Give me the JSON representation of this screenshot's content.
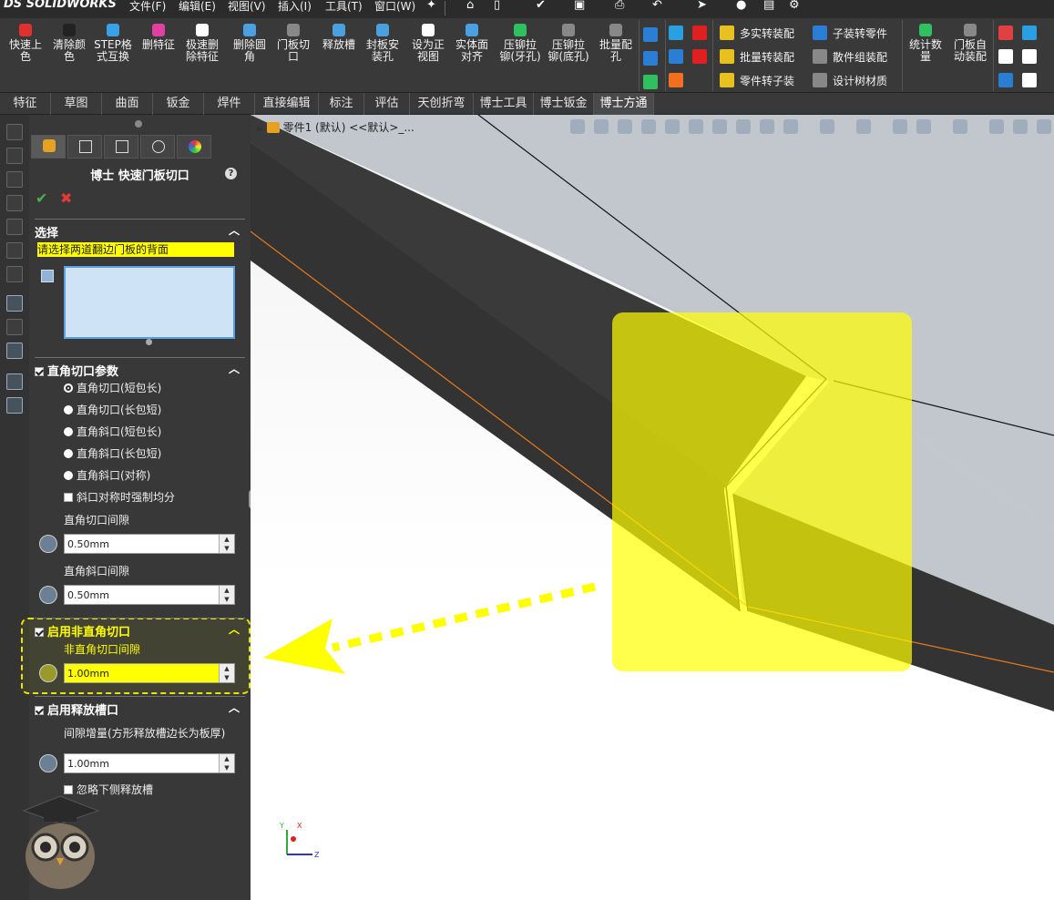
{
  "menubar": {
    "logo_ds": "DS",
    "logo_text": "SOLIDWORKS",
    "items": [
      "文件(F)",
      "编辑(E)",
      "视图(V)",
      "插入(I)",
      "工具(T)",
      "窗口(W)"
    ],
    "pin_icon": "pin-icon"
  },
  "ribbon": {
    "buttons": [
      {
        "label": "快速上\n色",
        "icon": "red-dot-icon",
        "color": "#e03030"
      },
      {
        "label": "清除颜\n色",
        "icon": "palette-icon",
        "color": "#222222"
      },
      {
        "label": "STEP格\n式互换",
        "icon": "globe-icon",
        "color": "#3aa0e8"
      },
      {
        "label": "删特征",
        "icon": "pink-delete-icon",
        "color": "#e040a0"
      },
      {
        "label": "极速删\n除特征",
        "icon": "n-icon",
        "color": "#ffffff"
      },
      {
        "label": "删除圆\n角",
        "icon": "fillet-icon",
        "color": "#4aa0e0"
      },
      {
        "label": "门板切\n口",
        "icon": "door-cut-icon",
        "color": "#888888"
      },
      {
        "label": "释放槽",
        "icon": "relief-icon",
        "color": "#4aa0e0"
      },
      {
        "label": "封板安\n装孔",
        "icon": "target-icon",
        "color": "#4aa0e0"
      },
      {
        "label": "设为正\n视图",
        "icon": "front-view-icon",
        "color": "#ffffff"
      },
      {
        "label": "实体面\n对齐",
        "icon": "align-icon",
        "color": "#4aa0e0"
      },
      {
        "label": "压铆拉\n铆(牙孔)",
        "icon": "rivet-icon",
        "color": "#30c060"
      },
      {
        "label": "压铆拉\n铆(底孔)",
        "icon": "rivet-bottom-icon",
        "color": "#888888"
      },
      {
        "label": "批量配\n孔",
        "icon": "batch-hole-icon",
        "color": "#888888"
      }
    ],
    "list_right": [
      {
        "label": "多实转装配",
        "icon": "multi-body-icon"
      },
      {
        "label": "批量转装配",
        "icon": "batch-assembly-icon"
      },
      {
        "label": "零件转子装",
        "icon": "part-sub-icon"
      },
      {
        "label": "子装转零件",
        "icon": "sub-part-icon"
      },
      {
        "label": "散件组装配",
        "icon": "parts-assembly-icon"
      },
      {
        "label": "设计树材质",
        "icon": "material-icon"
      }
    ],
    "stat_label": "统计数\n量",
    "door_auto_label": "门板自\n动装配"
  },
  "tabs": [
    "特征",
    "草图",
    "曲面",
    "钣金",
    "焊件",
    "直接编辑",
    "标注",
    "评估",
    "天创折弯",
    "博士工具",
    "博士钣金",
    "博士方通"
  ],
  "active_tab": "博士方通",
  "panel": {
    "title": "博士 快速门板切口",
    "help_icon": "help-icon",
    "ok_icon": "check-icon",
    "cancel_icon": "close-icon",
    "selection": {
      "header": "选择",
      "prompt": "请选择两道翻边门板的背面"
    },
    "right_angle": {
      "header": "直角切口参数",
      "options": [
        "直角切口(短包长)",
        "直角切口(长包短)",
        "直角斜口(短包长)",
        "直角斜口(长包短)",
        "直角斜口(对称)"
      ],
      "selected_index": 0,
      "force_even_label": "斜口对称时强制均分",
      "gap1_label": "直角切口间隙",
      "gap1_value": "0.50mm",
      "gap2_label": "直角斜口间隙",
      "gap2_value": "0.50mm"
    },
    "non_right": {
      "header": "启用非直角切口",
      "gap_label": "非直角切口间隙",
      "gap_value": "1.00mm"
    },
    "relief": {
      "header": "启用释放槽口",
      "gap_label": "间隙增量(方形释放槽边长为板厚)",
      "gap_value": "1.00mm",
      "ignore_label": "忽略下侧释放槽"
    }
  },
  "viewport": {
    "tree_label": "零件1 (默认) <<默认>_..."
  },
  "colors": {
    "highlight_yellow": "#ffff00",
    "panel_bg": "#383838",
    "edge_orange": "#e87a1a"
  }
}
